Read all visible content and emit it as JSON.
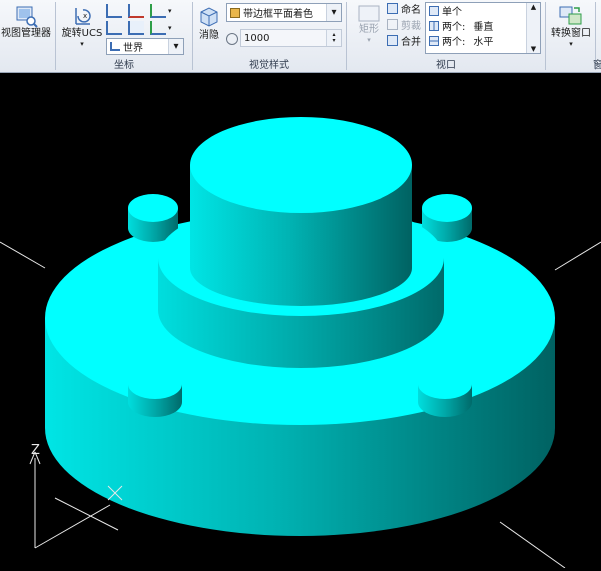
{
  "ribbon": {
    "viewport_tools": {
      "view_manager_label": "视图管理器"
    },
    "coordinates": {
      "panel_title": "坐标",
      "rotate_ucs_label": "旋转UCS",
      "ucs_combo_value": "世界"
    },
    "visual_styles": {
      "panel_title": "视觉样式",
      "style_combo_value": "带边框平面着色",
      "regen_label": "消隐",
      "value_field": "1000"
    },
    "viewports": {
      "panel_title": "视口",
      "rect_label": "矩形",
      "named_label": "命名",
      "clip_label": "剪裁",
      "join_label": "合并",
      "list": [
        {
          "label": "单个",
          "extra": ""
        },
        {
          "label": "两个:",
          "extra": "垂直"
        },
        {
          "label": "两个:",
          "extra": "水平"
        }
      ]
    },
    "switch": {
      "switch_window_label": "转换窗口",
      "cut_label": "窗"
    }
  },
  "viewport": {
    "axis_z_label": "Z",
    "model_color": "#00ffff",
    "background_color": "#000000"
  }
}
